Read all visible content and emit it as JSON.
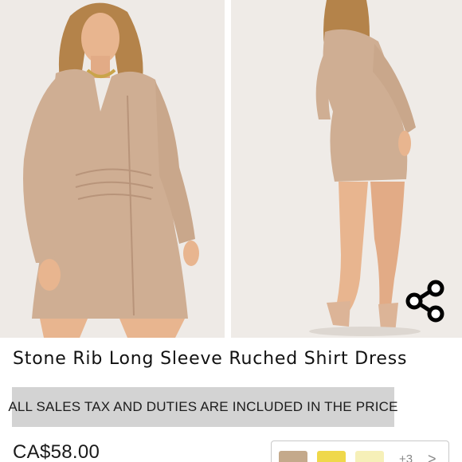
{
  "product": {
    "title": "Stone Rib Long Sleeve Ruched Shirt Dress",
    "tax_notice": "ALL SALES TAX AND DUTIES ARE INCLUDED IN THE PRICE",
    "price": "CA$58.00"
  },
  "gallery": {
    "photos": [
      "front-view-photo",
      "back-view-photo"
    ],
    "share_icon": "share-icon"
  },
  "colors": {
    "dress": "#cfae93",
    "dress_shadow": "#b8947a",
    "skin": "#e8b58f",
    "hair": "#b4834a",
    "background": "#ece8e4"
  },
  "swatches": [
    {
      "color": "#c4a98b"
    },
    {
      "color": "#efd84a"
    },
    {
      "color": "#f6f0b8"
    }
  ],
  "swatch_more": "+3",
  "swatch_next": ">"
}
